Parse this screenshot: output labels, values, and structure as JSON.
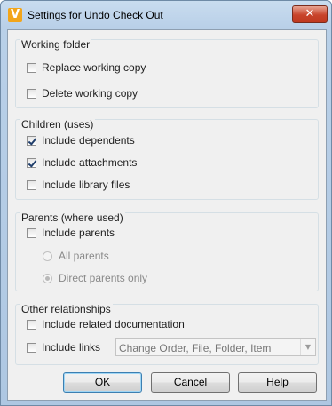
{
  "window": {
    "title": "Settings for Undo Check Out",
    "icon_letter": "V",
    "close_symbol": "✕"
  },
  "groups": {
    "working_folder": {
      "label": "Working folder",
      "options": [
        {
          "label": "Replace working copy",
          "checked": false
        },
        {
          "label": "Delete working copy",
          "checked": false
        }
      ]
    },
    "children": {
      "label": "Children (uses)",
      "options": [
        {
          "label": "Include dependents",
          "checked": true
        },
        {
          "label": "Include attachments",
          "checked": true
        },
        {
          "label": "Include library files",
          "checked": false
        }
      ]
    },
    "parents": {
      "label": "Parents (where used)",
      "include_parents": {
        "label": "Include parents",
        "checked": false
      },
      "radios": [
        {
          "label": "All parents",
          "selected": false
        },
        {
          "label": "Direct parents only",
          "selected": true
        }
      ]
    },
    "other": {
      "label": "Other relationships",
      "include_related": {
        "label": "Include related documentation",
        "checked": false
      },
      "include_links": {
        "label": "Include links",
        "checked": false
      },
      "links_combo_value": "Change Order, File, Folder, Item"
    }
  },
  "buttons": {
    "ok": "OK",
    "cancel": "Cancel",
    "help": "Help"
  }
}
